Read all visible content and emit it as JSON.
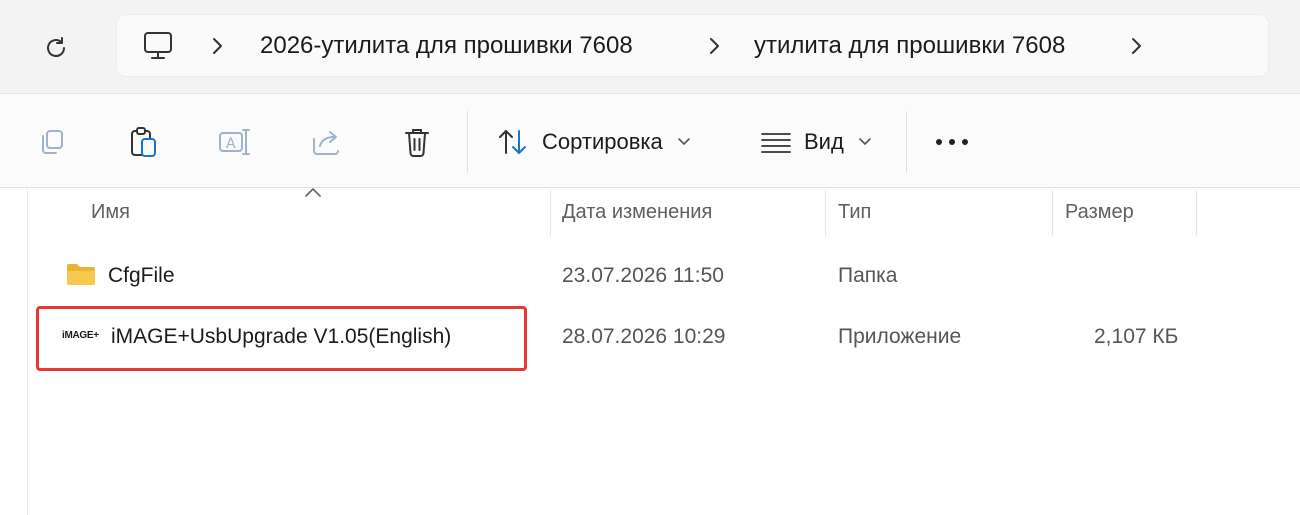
{
  "address": {
    "breadcrumbs": [
      {
        "label": "2026-утилита для прошивки 7608"
      },
      {
        "label": "утилита для прошивки 7608"
      }
    ]
  },
  "toolbar": {
    "sort_label": "Сортировка",
    "view_label": "Вид",
    "icons": [
      "copy-icon",
      "paste-icon",
      "rename-icon",
      "share-icon",
      "delete-icon",
      "sort-icon",
      "view-icon",
      "more-icon"
    ]
  },
  "columns": {
    "name": "Имя",
    "date": "Дата изменения",
    "type": "Тип",
    "size": "Размер"
  },
  "files": [
    {
      "name": "CfgFile",
      "date": "23.07.2026 11:50",
      "type": "Папка",
      "size": "",
      "icon": "folder-icon"
    },
    {
      "name": "iMAGE+UsbUpgrade V1.05(English)",
      "date": "28.07.2026 10:29",
      "type": "Приложение",
      "size": "2,107 КБ",
      "icon": "image-plus-app-icon",
      "logo_text": "iMAGE+"
    }
  ],
  "colors": {
    "highlight": "#e53935",
    "folder": "#f4c542"
  }
}
